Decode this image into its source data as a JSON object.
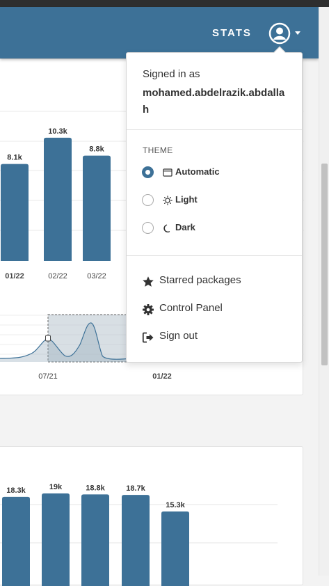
{
  "navbar": {
    "stats_label": "STATS",
    "user_icon": "user-circle-icon",
    "caret_icon": "caret-down-icon",
    "background": "#3d7197"
  },
  "user_menu": {
    "signed_in_label": "Signed in as",
    "username": "mohamed.abdelrazik.abdallah",
    "theme": {
      "label": "THEME",
      "selected": "Automatic",
      "options": [
        {
          "label": "Automatic",
          "icon": "window-icon",
          "checked": true
        },
        {
          "label": "Light",
          "icon": "sun-icon",
          "checked": false
        },
        {
          "label": "Dark",
          "icon": "moon-icon",
          "checked": false
        }
      ]
    },
    "items": [
      {
        "label": "Starred packages",
        "icon": "star-icon"
      },
      {
        "label": "Control Panel",
        "icon": "gear-icon"
      },
      {
        "label": "Sign out",
        "icon": "sign-out-icon"
      }
    ]
  },
  "chart_data": [
    {
      "type": "bar",
      "categories": [
        "",
        "01/22",
        "02/22",
        "03/22"
      ],
      "values": [
        null,
        8100,
        10300,
        8800
      ],
      "data_labels": [
        "",
        "8.1k",
        "10.3k",
        "8.8k"
      ],
      "bold_categories": [
        "01/22"
      ],
      "ylim": [
        0,
        12500
      ],
      "grid": true,
      "color": "#3d7197"
    },
    {
      "type": "area",
      "x_tick_labels": [
        "07/21",
        "01/22"
      ],
      "bold_ticks": [
        "01/22"
      ],
      "selection_range": [
        "07/21",
        ""
      ],
      "grid": true
    },
    {
      "type": "bar",
      "categories": [
        "",
        "",
        "",
        "",
        ""
      ],
      "values": [
        18300,
        19000,
        18800,
        18700,
        15300
      ],
      "data_labels": [
        "18.3k",
        "19k",
        "18.8k",
        "18.7k",
        "15.3k"
      ],
      "ylim": [
        0,
        25000
      ],
      "grid": true,
      "color": "#3d7197"
    }
  ]
}
